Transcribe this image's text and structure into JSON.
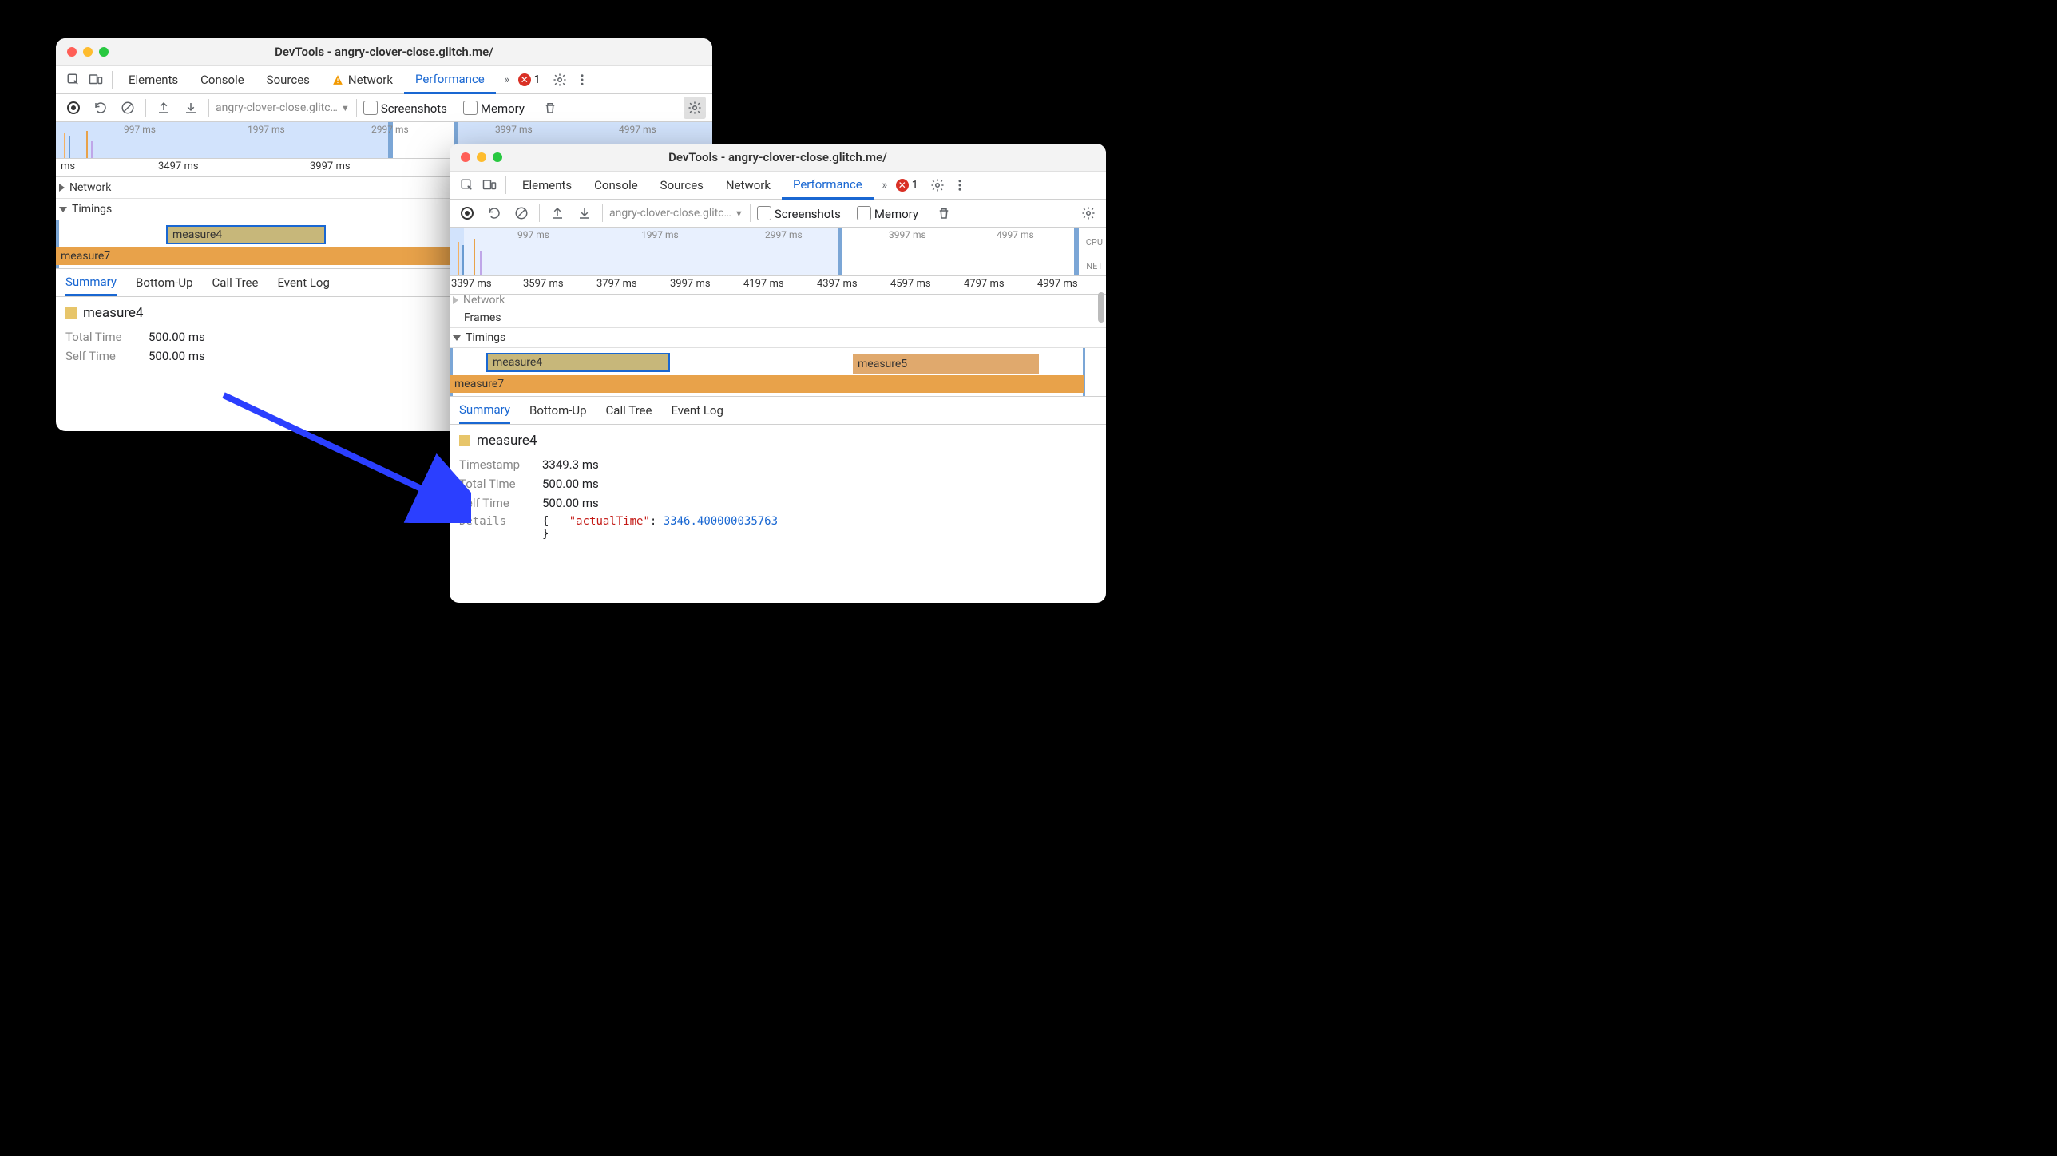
{
  "window_title": "DevTools - angry-clover-close.glitch.me/",
  "tabs": {
    "elements": "Elements",
    "console": "Console",
    "sources": "Sources",
    "network": "Network",
    "performance": "Performance"
  },
  "errors_count": "1",
  "perftool": {
    "url": "angry-clover-close.glitc…",
    "screenshots": "Screenshots",
    "memory": "Memory"
  },
  "overview_labels": {
    "cpu": "CPU",
    "net": "NET"
  },
  "win1": {
    "overview_ticks": [
      "997 ms",
      "1997 ms",
      "2997 ms",
      "3997 ms",
      "4997 ms"
    ],
    "ruler": {
      "ms_label": "ms",
      "t1": "3497 ms",
      "t2": "3997 ms"
    },
    "rows": {
      "network": "Network",
      "timings": "Timings"
    },
    "bars": {
      "m4": "measure4",
      "m7": "measure7"
    },
    "dtabs": {
      "summary": "Summary",
      "bottomup": "Bottom-Up",
      "calltree": "Call Tree",
      "eventlog": "Event Log"
    },
    "summary": {
      "name": "measure4",
      "totaltime_k": "Total Time",
      "totaltime_v": "500.00 ms",
      "selftime_k": "Self Time",
      "selftime_v": "500.00 ms"
    }
  },
  "win2": {
    "overview_ticks": [
      "997 ms",
      "1997 ms",
      "2997 ms",
      "3997 ms",
      "4997 ms"
    ],
    "ruler": [
      "3397 ms",
      "3597 ms",
      "3797 ms",
      "3997 ms",
      "4197 ms",
      "4397 ms",
      "4597 ms",
      "4797 ms",
      "4997 ms"
    ],
    "rows": {
      "frames": "Frames",
      "timings": "Timings",
      "network_partial": "Network"
    },
    "bars": {
      "m4": "measure4",
      "m5": "measure5",
      "m7": "measure7"
    },
    "dtabs": {
      "summary": "Summary",
      "bottomup": "Bottom-Up",
      "calltree": "Call Tree",
      "eventlog": "Event Log"
    },
    "summary": {
      "name": "measure4",
      "timestamp_k": "Timestamp",
      "timestamp_v": "3349.3 ms",
      "totaltime_k": "Total Time",
      "totaltime_v": "500.00 ms",
      "selftime_k": "Self Time",
      "selftime_v": "500.00 ms",
      "details_k": "Details",
      "json_open": "{",
      "json_key": "\"actualTime\"",
      "json_colon": ": ",
      "json_val": "3346.400000035763",
      "json_close": "}"
    }
  }
}
